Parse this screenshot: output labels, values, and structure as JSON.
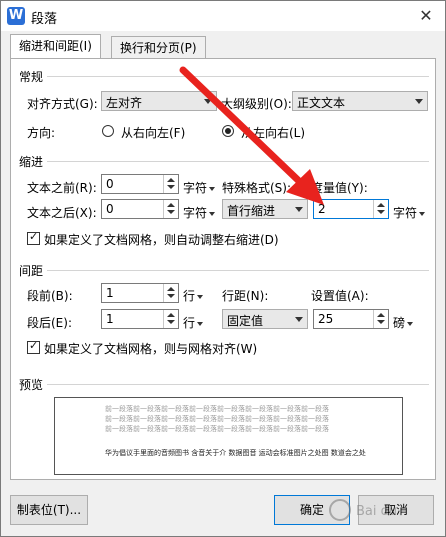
{
  "window": {
    "title": "段落",
    "close": "✕",
    "app_icon_letter": "W"
  },
  "tabs": [
    {
      "label": "缩进和间距(I)",
      "active": true
    },
    {
      "label": "换行和分页(P)",
      "active": false
    }
  ],
  "general": {
    "heading": "常规",
    "align_label": "对齐方式(G):",
    "align_value": "左对齐",
    "outline_label": "大纲级别(O):",
    "outline_value": "正文文本",
    "direction_label": "方向:",
    "rtl_label": "从右向左(F)",
    "ltr_label": "从左向右(L)",
    "ltr_selected": true
  },
  "indent": {
    "heading": "缩进",
    "before_label": "文本之前(R):",
    "before_value": "0",
    "before_unit": "字符",
    "after_label": "文本之后(X):",
    "after_value": "0",
    "after_unit": "字符",
    "special_label": "特殊格式(S):",
    "special_value": "首行缩进",
    "measure_label": "度量值(Y):",
    "measure_value": "2",
    "measure_unit": "字符",
    "grid_check_label": "如果定义了文档网格，则自动调整右缩进(D)"
  },
  "spacing": {
    "heading": "间距",
    "before_label": "段前(B):",
    "before_value": "1",
    "before_unit": "行",
    "after_label": "段后(E):",
    "after_value": "1",
    "after_unit": "行",
    "line_label": "行距(N):",
    "line_value": "固定值",
    "setting_label": "设置值(A):",
    "setting_value": "25",
    "setting_unit": "磅",
    "grid_check_label": "如果定义了文档网格，则与网格对齐(W)"
  },
  "preview": {
    "heading": "预览",
    "prev_lines": [
      "前一段落前一段落前一段落前一段落前一段落前一段落前一段落前一段落",
      "前一段落前一段落前一段落前一段落前一段落前一段落前一段落前一段落",
      "前一段落前一段落前一段落前一段落前一段落前一段落前一段落前一段落"
    ],
    "sample_text": "华为倡议手里面的音频图书   含音关于介   数据图音   运动会标准图片之处图   数道会之处"
  },
  "buttons": {
    "tabs_btn": "制表位(T)...",
    "ok": "确定",
    "cancel": "取消"
  },
  "colors": {
    "arrow": "#e8231e",
    "accent": "#0078d7",
    "app_icon": "#2b6fd6"
  }
}
